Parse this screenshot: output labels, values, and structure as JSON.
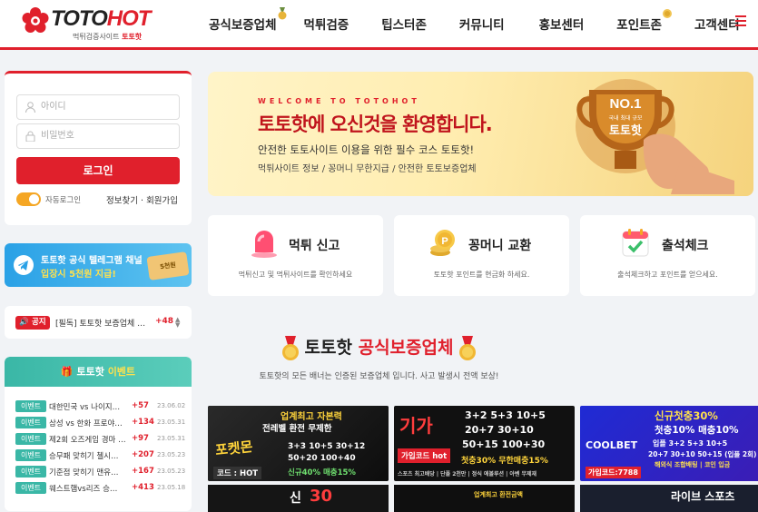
{
  "brand": {
    "name_a": "TOTO",
    "name_b": "HOT",
    "tagline_a": "먹튀검증사이트",
    "tagline_b": "토토핫"
  },
  "nav": {
    "items": [
      "공식보증업체",
      "먹튀검증",
      "팁스터존",
      "커뮤니티",
      "홍보센터",
      "포인트존",
      "고객센터"
    ]
  },
  "login": {
    "id_placeholder": "아이디",
    "pw_placeholder": "비밀번호",
    "login_button": "로그인",
    "auto_login": "자동로그인",
    "find_info": "정보찾기",
    "signup": "회원가입",
    "separator": "·"
  },
  "telegram": {
    "line1": "토토핫 공식 텔레그램 채널",
    "line2": "입장시 5천원 지급!",
    "coupon": "5천원"
  },
  "notice": {
    "tag": "공지",
    "text": "[필독] 토토핫 보증업체 …",
    "count": "+48"
  },
  "events": {
    "title_a": "토토핫",
    "title_b": "이벤트",
    "tag": "이벤트",
    "rows": [
      {
        "title": "대한민국 vs 나이지…",
        "pts": "+57",
        "date": "23.06.02"
      },
      {
        "title": "삼성 vs 한화 프로야…",
        "pts": "+134",
        "date": "23.05.31"
      },
      {
        "title": "제2회 오즈게임 경마 …",
        "pts": "+97",
        "date": "23.05.31"
      },
      {
        "title": "승무패 맞히기 첼시…",
        "pts": "+207",
        "date": "23.05.23"
      },
      {
        "title": "기준점 맞히기 맨유…",
        "pts": "+167",
        "date": "23.05.23"
      },
      {
        "title": "웨스트햄vs리즈 승…",
        "pts": "+413",
        "date": "23.05.18"
      }
    ]
  },
  "hero": {
    "welcome": "WELCOME TO TOTOHOT",
    "title": "토토핫에 오신것을 환영합니다.",
    "desc1": "안전한 토토사이트 이용을 위한 필수 코스 토토핫!",
    "desc2": "먹튀사이트 정보 / 꽁머니 무한지급 / 안전한 토토보증업체",
    "badge": "NO.1",
    "badge_sub": "국내 최대 규모",
    "badge_big": "토토핫"
  },
  "cards": [
    {
      "title": "먹튀 신고",
      "desc": "먹튀신고 및 먹튀사이트를 확인하세요",
      "icon": "siren-icon"
    },
    {
      "title": "꽁머니 교환",
      "desc": "토토핫 포인트를 현금화 하세요.",
      "icon": "coin-icon"
    },
    {
      "title": "출석체크",
      "desc": "출석체크하고 포인트를 얻으세요.",
      "icon": "calendar-check-icon"
    }
  ],
  "section": {
    "title_a": "토토핫",
    "title_b": "공식보증업체",
    "desc": "토토핫의 모든 배너는 인증된 보증업체 입니다. 사고 발생시 전액 보상!"
  },
  "banners": [
    {
      "l1": "업계최고 자본력",
      "l2": "전레벨 환전 무제한",
      "logo": "포켓몬",
      "l3": "3+3 10+5 30+12",
      "l4": "50+20 100+40",
      "l5": "신규40% 매충15%",
      "code": "코드 : HOT"
    },
    {
      "l1": "기가",
      "l2": "3+2 5+3 10+5",
      "l3": "20+7 30+10",
      "l4": "50+15 100+30",
      "l5": "첫충30% 무한매충15%",
      "code": "가입코드 hot",
      "l6": "스포츠 최고배당 | 단폴 2천만 | 정식 에볼루션 | 아벤 무제재"
    },
    {
      "l1": "신규첫충30%",
      "l2": "첫충10% 매충10%",
      "logo": "COOLBET",
      "l3": "입플 3+2 5+3 10+5",
      "l4": "20+7 30+10 50+15 (입플 2회)",
      "l5": "해외식 조합배팅 | 코인 입금",
      "code": "가입코드:7788"
    },
    {
      "l1": "신",
      "l2": "30"
    },
    {
      "l1": "업계최고 환전금액"
    },
    {
      "l1": "라이브 스포츠"
    }
  ],
  "colors": {
    "accent": "#e0202c",
    "teal": "#3ab7a6",
    "gold": "#f5a623",
    "telegram": "#2aa1e6"
  }
}
